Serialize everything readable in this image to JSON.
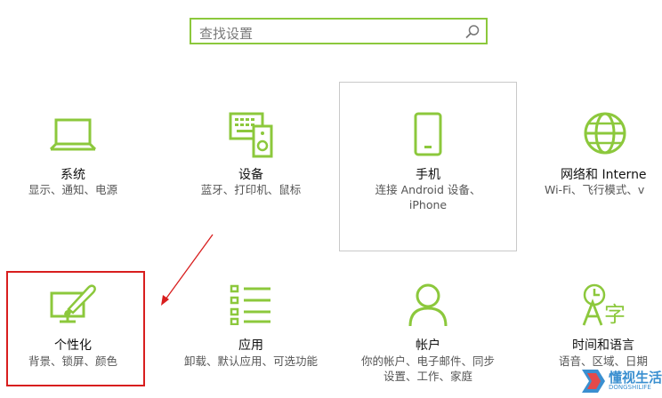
{
  "search": {
    "placeholder": "查找设置",
    "icon": "search-icon"
  },
  "accent_color": "#8cc83c",
  "tiles": [
    {
      "title": "系统",
      "desc": [
        "显示、通知、电源"
      ],
      "icon": "laptop-icon"
    },
    {
      "title": "设备",
      "desc": [
        "蓝牙、打印机、鼠标"
      ],
      "icon": "devices-icon"
    },
    {
      "title": "手机",
      "desc": [
        "连接 Android 设备、",
        "iPhone"
      ],
      "icon": "phone-icon"
    },
    {
      "title": "网络和 Interne",
      "desc": [
        "Wi-Fi、飞行模式、v"
      ],
      "icon": "globe-icon"
    },
    {
      "title": "个性化",
      "desc": [
        "背景、锁屏、颜色"
      ],
      "icon": "personalization-icon"
    },
    {
      "title": "应用",
      "desc": [
        "卸载、默认应用、可选功能"
      ],
      "icon": "apps-list-icon"
    },
    {
      "title": "帐户",
      "desc": [
        "你的帐户、电子邮件、同步",
        "设置、工作、家庭"
      ],
      "icon": "person-icon"
    },
    {
      "title": "时间和语言",
      "desc": [
        "语音、区域、日期"
      ],
      "icon": "time-language-icon"
    }
  ],
  "annotation": {
    "highlight_color": "#d81e1e"
  },
  "watermark": {
    "text": "懂视生活",
    "sub": "DONGSHILIFE"
  }
}
